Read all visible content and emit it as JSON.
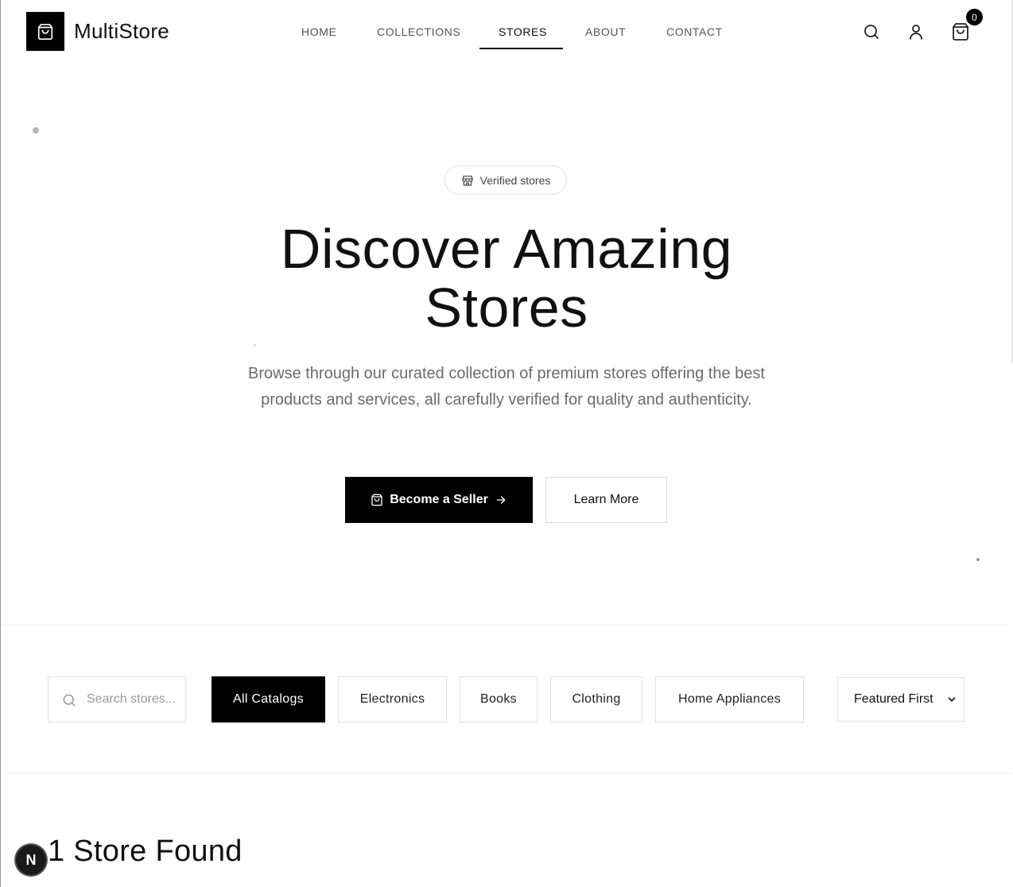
{
  "header": {
    "brand": "MultiStore",
    "nav": [
      {
        "label": "HOME"
      },
      {
        "label": "COLLECTIONS"
      },
      {
        "label": "STORES",
        "active": true
      },
      {
        "label": "ABOUT"
      },
      {
        "label": "CONTACT"
      }
    ],
    "cart_count": "0",
    "icons": [
      "shopping-bag-icon",
      "search-icon",
      "user-icon",
      "cart-icon"
    ]
  },
  "hero": {
    "badge": "Verified stores",
    "title_line1": "Discover Amazing",
    "title_line2": "Stores",
    "description": "Browse through our curated collection of premium stores offering the best products and services, all carefully verified for quality and authenticity.",
    "primary_button": "Become a Seller",
    "secondary_button": "Learn More"
  },
  "filters": {
    "search_placeholder": "Search stores...",
    "categories": [
      {
        "label": "All Catalogs",
        "active": true
      },
      {
        "label": "Electronics"
      },
      {
        "label": "Books"
      },
      {
        "label": "Clothing"
      },
      {
        "label": "Home Appliances"
      }
    ],
    "sort_selected": "Featured First"
  },
  "results": {
    "count_text": "1 Store Found"
  },
  "dev_badge": "N",
  "colors": {
    "accent": "#000000",
    "muted_text": "#6b6b6b",
    "border": "#e2e2e2"
  }
}
